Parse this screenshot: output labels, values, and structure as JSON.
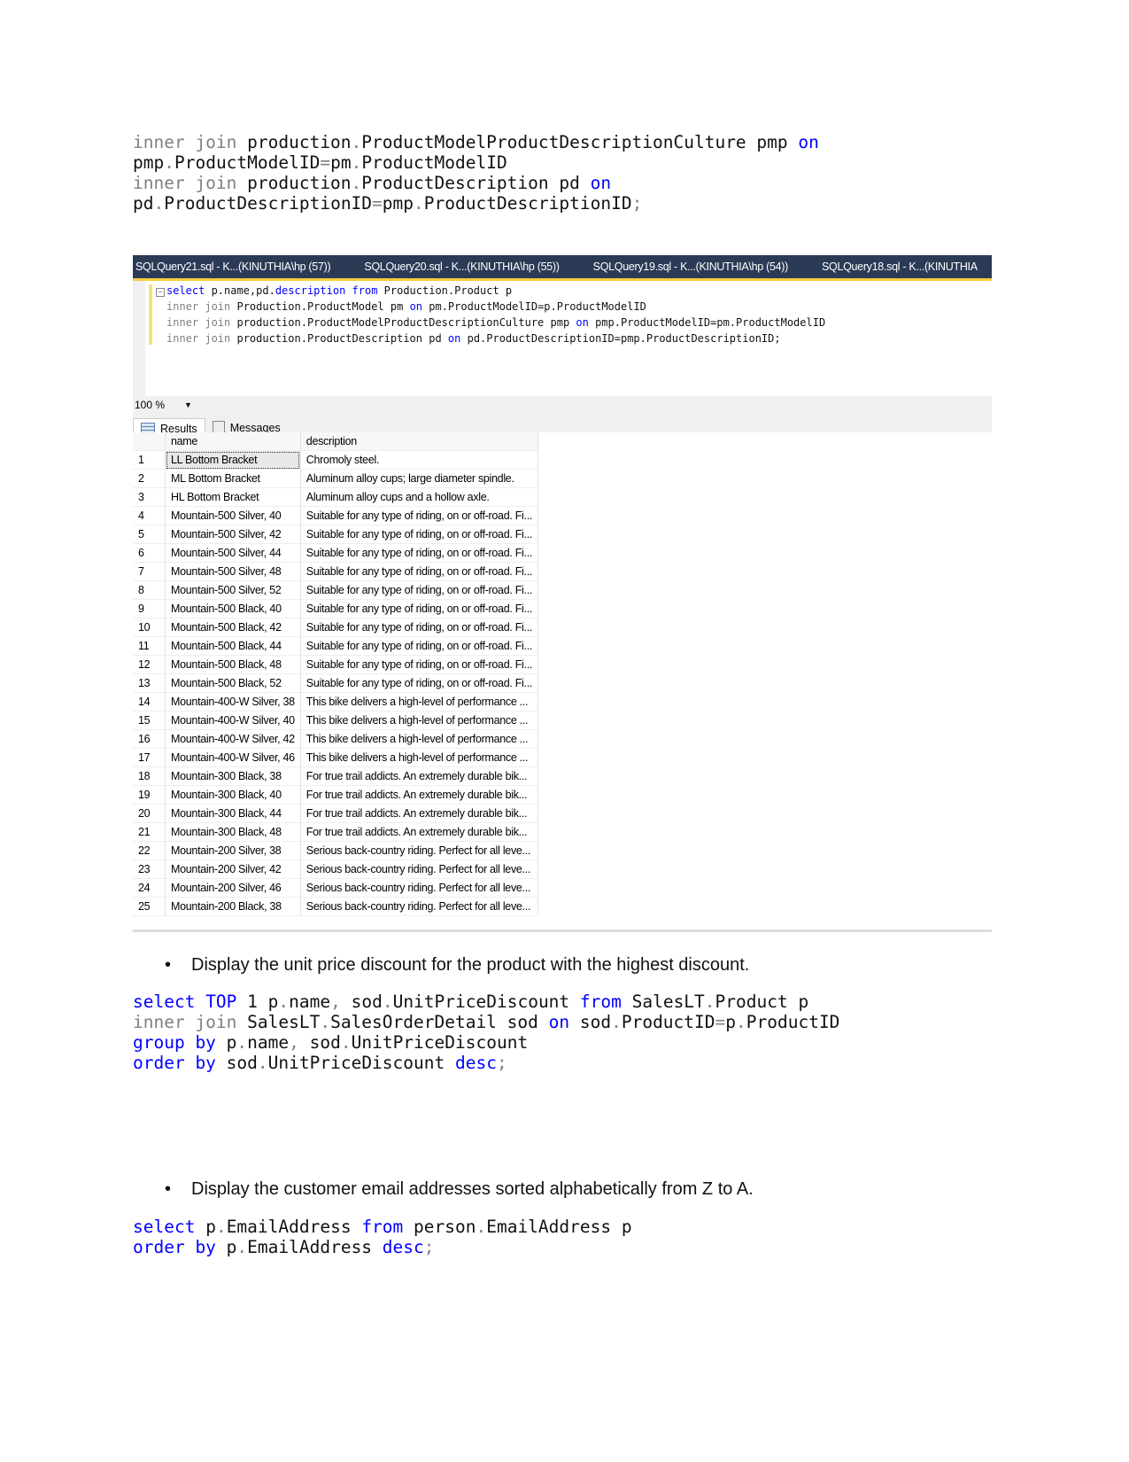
{
  "top_code": [
    [
      {
        "t": "inner join ",
        "c": "gr"
      },
      {
        "t": "production",
        "c": ""
      },
      {
        "t": ".",
        "c": "gr"
      },
      {
        "t": "ProductModelProductDescriptionCulture pmp ",
        "c": ""
      },
      {
        "t": "on",
        "c": "kw"
      }
    ],
    [
      {
        "t": "pmp",
        "c": ""
      },
      {
        "t": ".",
        "c": "gr"
      },
      {
        "t": "ProductModelID",
        "c": ""
      },
      {
        "t": "=",
        "c": "gr"
      },
      {
        "t": "pm",
        "c": ""
      },
      {
        "t": ".",
        "c": "gr"
      },
      {
        "t": "ProductModelID",
        "c": ""
      }
    ],
    [
      {
        "t": "inner join ",
        "c": "gr"
      },
      {
        "t": "production",
        "c": ""
      },
      {
        "t": ".",
        "c": "gr"
      },
      {
        "t": "ProductDescription pd ",
        "c": ""
      },
      {
        "t": "on",
        "c": "kw"
      }
    ],
    [
      {
        "t": "pd",
        "c": ""
      },
      {
        "t": ".",
        "c": "gr"
      },
      {
        "t": "ProductDescriptionID",
        "c": ""
      },
      {
        "t": "=",
        "c": "gr"
      },
      {
        "t": "pmp",
        "c": ""
      },
      {
        "t": ".",
        "c": "gr"
      },
      {
        "t": "ProductDescriptionID",
        "c": ""
      },
      {
        "t": ";",
        "c": "gr"
      }
    ]
  ],
  "ssms": {
    "tabs": [
      "SQLQuery21.sql - K...(KINUTHIA\\hp (57))",
      "SQLQuery20.sql - K...(KINUTHIA\\hp (55))",
      "SQLQuery19.sql - K...(KINUTHIA\\hp (54))",
      "SQLQuery18.sql - K...(KINUTHIA"
    ],
    "editor_lines": [
      [
        {
          "t": "select ",
          "c": "kw"
        },
        {
          "t": "p.name,pd.",
          "c": ""
        },
        {
          "t": "description ",
          "c": "kw"
        },
        {
          "t": "from ",
          "c": "kw"
        },
        {
          "t": "Production.Product p",
          "c": ""
        }
      ],
      [
        {
          "t": "inner join ",
          "c": "gr"
        },
        {
          "t": "Production.ProductModel pm ",
          "c": ""
        },
        {
          "t": "on ",
          "c": "kw"
        },
        {
          "t": "pm.ProductModelID=p.ProductModelID",
          "c": ""
        }
      ],
      [
        {
          "t": "inner join ",
          "c": "gr"
        },
        {
          "t": "production.ProductModelProductDescriptionCulture pmp ",
          "c": ""
        },
        {
          "t": "on ",
          "c": "kw"
        },
        {
          "t": "pmp.ProductModelID=pm.ProductModelID",
          "c": ""
        }
      ],
      [
        {
          "t": "inner join ",
          "c": "gr"
        },
        {
          "t": "production.ProductDescription pd ",
          "c": ""
        },
        {
          "t": "on ",
          "c": "kw"
        },
        {
          "t": "pd.ProductDescriptionID=pmp.ProductDescriptionID;",
          "c": ""
        }
      ]
    ],
    "zoom": "100 %",
    "result_tabs": [
      "Results",
      "Messages"
    ],
    "columns": [
      "name",
      "description"
    ],
    "rows": [
      [
        "1",
        "LL Bottom Bracket",
        "Chromoly steel."
      ],
      [
        "2",
        "ML Bottom Bracket",
        "Aluminum alloy cups; large diameter spindle."
      ],
      [
        "3",
        "HL Bottom Bracket",
        "Aluminum alloy cups and a hollow axle."
      ],
      [
        "4",
        "Mountain-500 Silver, 40",
        "Suitable for any type of riding, on or off-road. Fi..."
      ],
      [
        "5",
        "Mountain-500 Silver, 42",
        "Suitable for any type of riding, on or off-road. Fi..."
      ],
      [
        "6",
        "Mountain-500 Silver, 44",
        "Suitable for any type of riding, on or off-road. Fi..."
      ],
      [
        "7",
        "Mountain-500 Silver, 48",
        "Suitable for any type of riding, on or off-road. Fi..."
      ],
      [
        "8",
        "Mountain-500 Silver, 52",
        "Suitable for any type of riding, on or off-road. Fi..."
      ],
      [
        "9",
        "Mountain-500 Black, 40",
        "Suitable for any type of riding, on or off-road. Fi..."
      ],
      [
        "10",
        "Mountain-500 Black, 42",
        "Suitable for any type of riding, on or off-road. Fi..."
      ],
      [
        "11",
        "Mountain-500 Black, 44",
        "Suitable for any type of riding, on or off-road. Fi..."
      ],
      [
        "12",
        "Mountain-500 Black, 48",
        "Suitable for any type of riding, on or off-road. Fi..."
      ],
      [
        "13",
        "Mountain-500 Black, 52",
        "Suitable for any type of riding, on or off-road. Fi..."
      ],
      [
        "14",
        "Mountain-400-W Silver, 38",
        "This bike delivers a high-level of performance ..."
      ],
      [
        "15",
        "Mountain-400-W Silver, 40",
        "This bike delivers a high-level of performance ..."
      ],
      [
        "16",
        "Mountain-400-W Silver, 42",
        "This bike delivers a high-level of performance ..."
      ],
      [
        "17",
        "Mountain-400-W Silver, 46",
        "This bike delivers a high-level of performance ..."
      ],
      [
        "18",
        "Mountain-300 Black, 38",
        "For true trail addicts.  An extremely durable bik..."
      ],
      [
        "19",
        "Mountain-300 Black, 40",
        "For true trail addicts.  An extremely durable bik..."
      ],
      [
        "20",
        "Mountain-300 Black, 44",
        "For true trail addicts.  An extremely durable bik..."
      ],
      [
        "21",
        "Mountain-300 Black, 48",
        "For true trail addicts.  An extremely durable bik..."
      ],
      [
        "22",
        "Mountain-200 Silver, 38",
        "Serious back-country riding. Perfect for all leve..."
      ],
      [
        "23",
        "Mountain-200 Silver, 42",
        "Serious back-country riding. Perfect for all leve..."
      ],
      [
        "24",
        "Mountain-200 Silver, 46",
        "Serious back-country riding. Perfect for all leve..."
      ],
      [
        "25",
        "Mountain-200 Black, 38",
        "Serious back-country riding. Perfect for all leve..."
      ]
    ]
  },
  "bullet1": "Display the unit price discount for the product with the highest discount.",
  "code2": [
    [
      {
        "t": "select ",
        "c": "kw"
      },
      {
        "t": "TOP ",
        "c": "kw"
      },
      {
        "t": "1 p",
        "c": ""
      },
      {
        "t": ".",
        "c": "gr"
      },
      {
        "t": "name",
        "c": ""
      },
      {
        "t": ", ",
        "c": "gr"
      },
      {
        "t": "sod",
        "c": ""
      },
      {
        "t": ".",
        "c": "gr"
      },
      {
        "t": "UnitPriceDiscount ",
        "c": ""
      },
      {
        "t": "from ",
        "c": "kw"
      },
      {
        "t": "SalesLT",
        "c": ""
      },
      {
        "t": ".",
        "c": "gr"
      },
      {
        "t": "Product p",
        "c": ""
      }
    ],
    [
      {
        "t": "inner join ",
        "c": "gr"
      },
      {
        "t": "SalesLT",
        "c": ""
      },
      {
        "t": ".",
        "c": "gr"
      },
      {
        "t": "SalesOrderDetail sod ",
        "c": ""
      },
      {
        "t": "on ",
        "c": "kw"
      },
      {
        "t": "sod",
        "c": ""
      },
      {
        "t": ".",
        "c": "gr"
      },
      {
        "t": "ProductID",
        "c": ""
      },
      {
        "t": "=",
        "c": "gr"
      },
      {
        "t": "p",
        "c": ""
      },
      {
        "t": ".",
        "c": "gr"
      },
      {
        "t": "ProductID",
        "c": ""
      }
    ],
    [
      {
        "t": "group by ",
        "c": "kw"
      },
      {
        "t": "p",
        "c": ""
      },
      {
        "t": ".",
        "c": "gr"
      },
      {
        "t": "name",
        "c": ""
      },
      {
        "t": ", ",
        "c": "gr"
      },
      {
        "t": "sod",
        "c": ""
      },
      {
        "t": ".",
        "c": "gr"
      },
      {
        "t": "UnitPriceDiscount",
        "c": ""
      }
    ],
    [
      {
        "t": "order by ",
        "c": "kw"
      },
      {
        "t": "sod",
        "c": ""
      },
      {
        "t": ".",
        "c": "gr"
      },
      {
        "t": "UnitPriceDiscount ",
        "c": ""
      },
      {
        "t": "desc",
        "c": "kw"
      },
      {
        "t": ";",
        "c": "gr"
      }
    ]
  ],
  "bullet2": "Display the customer email addresses sorted alphabetically from Z to A.",
  "code3": [
    [
      {
        "t": "select ",
        "c": "kw"
      },
      {
        "t": "p",
        "c": ""
      },
      {
        "t": ".",
        "c": "gr"
      },
      {
        "t": "EmailAddress ",
        "c": ""
      },
      {
        "t": "from ",
        "c": "kw"
      },
      {
        "t": "person",
        "c": ""
      },
      {
        "t": ".",
        "c": "gr"
      },
      {
        "t": "EmailAddress p",
        "c": ""
      }
    ],
    [
      {
        "t": "order by ",
        "c": "kw"
      },
      {
        "t": "p",
        "c": ""
      },
      {
        "t": ".",
        "c": "gr"
      },
      {
        "t": "EmailAddress ",
        "c": ""
      },
      {
        "t": "desc",
        "c": "kw"
      },
      {
        "t": ";",
        "c": "gr"
      }
    ]
  ]
}
